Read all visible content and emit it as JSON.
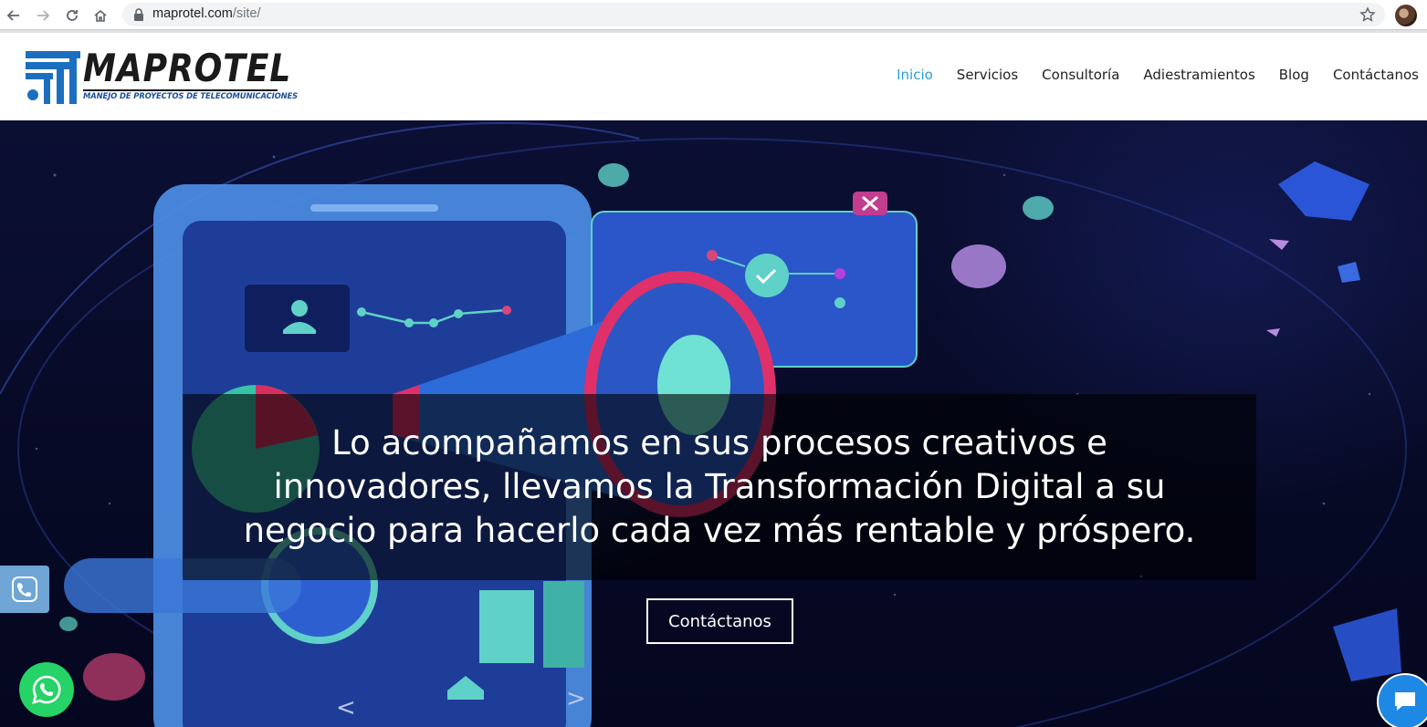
{
  "browser": {
    "url_host": "maprotel.com",
    "url_path": "/site/"
  },
  "header": {
    "logo_name": "MAPROTEL",
    "logo_tagline": "MANEJO DE PROYECTOS DE TELECOMUNICACIONES",
    "menu": [
      {
        "label": "Inicio",
        "active": true
      },
      {
        "label": "Servicios",
        "active": false
      },
      {
        "label": "Consultoría",
        "active": false
      },
      {
        "label": "Adiestramientos",
        "active": false
      },
      {
        "label": "Blog",
        "active": false
      },
      {
        "label": "Contáctanos",
        "active": false
      }
    ]
  },
  "hero": {
    "headline_lines": [
      "Lo acompañamos en sus procesos creativos e",
      "innovadores, llevamos la Transformación Digital a su",
      "negocio para hacerlo cada vez más rentable y próspero."
    ],
    "cta_label": "Contáctanos"
  },
  "floating": {
    "phone_icon": "phone-icon",
    "whatsapp_icon": "whatsapp-icon",
    "chat_icon": "chat-icon"
  },
  "colors": {
    "accent": "#2e9bd6",
    "whatsapp": "#25d366",
    "chat": "#1e88e5"
  }
}
